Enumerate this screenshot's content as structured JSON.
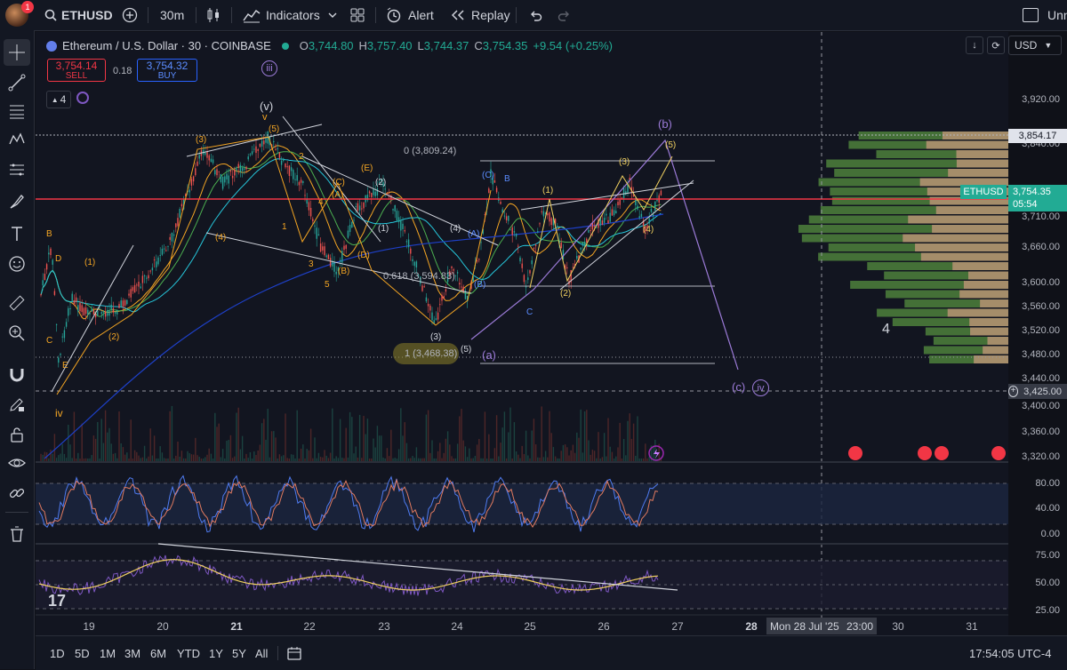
{
  "toolbar": {
    "notification_count": "1",
    "symbol": "ETHUSD",
    "interval": "30m",
    "indicators_label": "Indicators",
    "alert_label": "Alert",
    "replay_label": "Replay",
    "unnamed_label": "Unn"
  },
  "legend": {
    "title": "Ethereum / U.S. Dollar · 30 · COINBASE",
    "o_label": "O",
    "o": "3,744.80",
    "h_label": "H",
    "h": "3,757.40",
    "l_label": "L",
    "l": "3,744.37",
    "c_label": "C",
    "c": "3,754.35",
    "change": "+9.54 (+0.25%)",
    "sell_price": "3,754.14",
    "sell_label": "SELL",
    "spread": "0.18",
    "buy_price": "3,754.32",
    "buy_label": "BUY",
    "indicator_count": "4",
    "currency": "USD"
  },
  "price_axis": {
    "ticks": [
      "3,920.00",
      "3,710.00",
      "3,660.00",
      "3,600.00",
      "3,560.00",
      "3,520.00",
      "3,480.00",
      "3,440.00",
      "3,400.00",
      "3,360.00",
      "3,320.00"
    ],
    "marker_3854": "3,854.17",
    "marker_3840": "3,840.00",
    "current_price": "3,754.35",
    "countdown": "05:54",
    "symbol_tag": "ETHUSD",
    "crosshair_price": "3,425.00",
    "osc1_ticks": [
      "80.00",
      "40.00",
      "0.00"
    ],
    "osc2_ticks": [
      "75.00",
      "50.00",
      "25.00"
    ]
  },
  "annotations": {
    "fib_0": "0 (3,809.24)",
    "fib_0618": "0.618 (3,594.83)",
    "fib_1": "1 (3,468.38)",
    "wave_iii": "iii",
    "wave_v_top": "(v)",
    "wave_v": "v",
    "wave_b_top": "(b)",
    "wave_a_paren": "(a)",
    "wave_c_paren": "(c)",
    "wave_iv_circle": "iv",
    "wave_iv_left": "iv",
    "label_4": "4",
    "labels_orange": [
      "(3)",
      "(5)",
      "3",
      "4",
      "1",
      "5",
      "(1)",
      "(2)",
      "(3)",
      "(5)",
      "(4)"
    ],
    "labels_misc": [
      "B",
      "D",
      "C",
      "E",
      "(C)",
      "B",
      "C",
      "(A)",
      "(B)"
    ]
  },
  "time_axis": {
    "ticks": [
      "19",
      "20",
      "21",
      "22",
      "23",
      "24",
      "25",
      "26",
      "27",
      "28",
      "30",
      "31"
    ],
    "crosshair_date": "Mon 28 Jul '25",
    "crosshair_time": "23:00"
  },
  "bottom": {
    "ranges": [
      "1D",
      "5D",
      "1M",
      "3M",
      "6M",
      "YTD",
      "1Y",
      "5Y",
      "All"
    ],
    "clock": "17:54:05 UTC-4"
  },
  "colors": {
    "up": "#26a69a",
    "down": "#ef5350",
    "accent": "#2962ff",
    "wave_orange": "#f5a623",
    "wave_yellow": "#f0d060",
    "wave_purple": "#9c7bd8",
    "price_line": "#f23645"
  }
}
